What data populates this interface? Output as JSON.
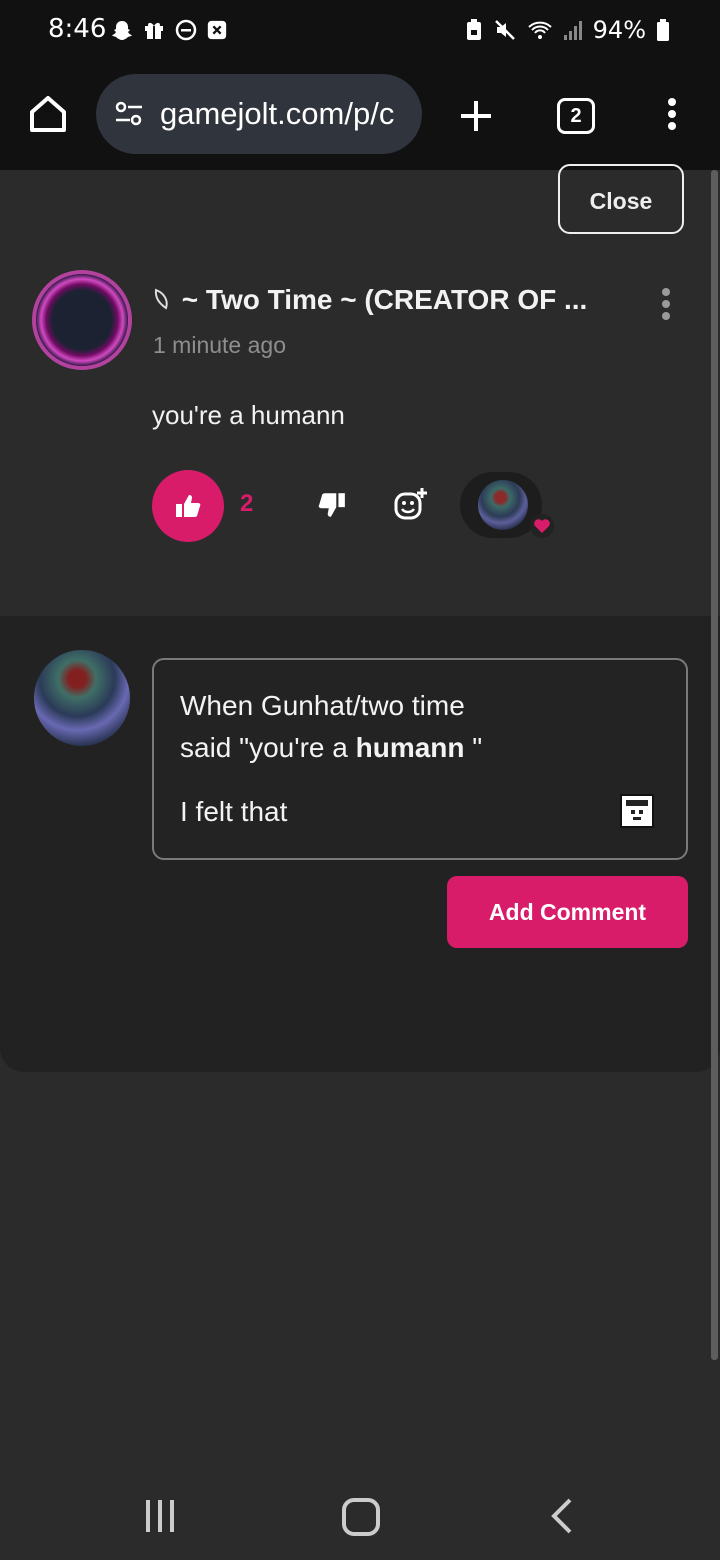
{
  "status_bar": {
    "time": "8:46",
    "battery": "94%",
    "left_icons": [
      "snapchat-icon",
      "gift-icon",
      "do-not-disturb-icon",
      "close-box-icon"
    ],
    "right_icons": [
      "lock-battery-icon",
      "mute-icon",
      "wifi-icon",
      "signal-icon",
      "battery-icon"
    ]
  },
  "browser": {
    "url": "gamejolt.com/p/c",
    "tab_count": "2"
  },
  "comment": {
    "close_label": "Close",
    "author_name": "~ Two Time ~ (CREATOR OF ...",
    "time_ago": "1 minute ago",
    "body": "you're a humann",
    "like_count": "2"
  },
  "reply": {
    "line1": "When Gunhat/two time",
    "line2_prefix": "said \"you're a ",
    "line2_bold": "humann",
    "line2_suffix": " \"",
    "line3": "I felt that",
    "submit_label": "Add Comment"
  },
  "colors": {
    "accent": "#d81c6a",
    "overlay_bg": "#222222",
    "page_bg": "#2b2b2b",
    "bar_bg": "#111111"
  }
}
